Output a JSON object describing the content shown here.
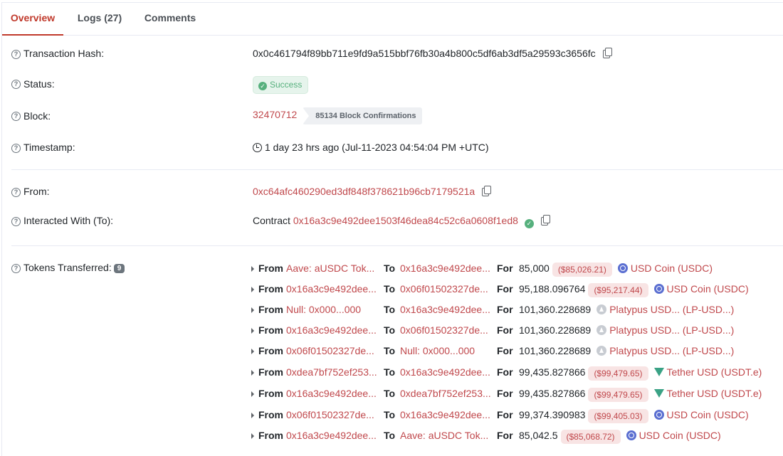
{
  "tabs": [
    {
      "label": "Overview",
      "active": true
    },
    {
      "label": "Logs (27)",
      "active": false
    },
    {
      "label": "Comments",
      "active": false
    }
  ],
  "fields": {
    "tx_hash_label": "Transaction Hash:",
    "tx_hash": "0x0c461794f89bb711e9fd9a515bbf76fb30a4b800c5df6ab3df5a29593c3656fc",
    "status_label": "Status:",
    "status": "Success",
    "block_label": "Block:",
    "block": "32470712",
    "confirmations": "85134 Block Confirmations",
    "timestamp_label": "Timestamp:",
    "timestamp": "1 day 23 hrs ago (Jul-11-2023 04:54:04 PM +UTC)",
    "from_label": "From:",
    "from": "0xc64afc460290ed3df848f378621b96cb7179521a",
    "to_label": "Interacted With (To):",
    "to_prefix": "Contract",
    "to": "0x16a3c9e492dee1503f46dea84c52c6a0608f1ed8",
    "tokens_label": "Tokens Transferred:",
    "tokens_count": "9"
  },
  "transfer_keywords": {
    "from": "From",
    "to": "To",
    "for": "For"
  },
  "transfers": [
    {
      "from": "Aave: aUSDC Tok...",
      "to": "0x16a3c9e492dee...",
      "amount": "85,000",
      "usd": "($85,026.21)",
      "token": "USD Coin (USDC)",
      "icon": "usdc"
    },
    {
      "from": "0x16a3c9e492dee...",
      "to": "0x06f01502327de...",
      "amount": "95,188.096764",
      "usd": "($95,217.44)",
      "token": "USD Coin (USDC)",
      "icon": "usdc"
    },
    {
      "from": "Null: 0x000...000",
      "to": "0x16a3c9e492dee...",
      "amount": "101,360.228689",
      "usd": "",
      "token": "Platypus USD... (LP-USD...)",
      "icon": "lp"
    },
    {
      "from": "0x16a3c9e492dee...",
      "to": "0x06f01502327de...",
      "amount": "101,360.228689",
      "usd": "",
      "token": "Platypus USD... (LP-USD...)",
      "icon": "lp"
    },
    {
      "from": "0x06f01502327de...",
      "to": "Null: 0x000...000",
      "amount": "101,360.228689",
      "usd": "",
      "token": "Platypus USD... (LP-USD...)",
      "icon": "lp"
    },
    {
      "from": "0xdea7bf752ef253...",
      "to": "0x16a3c9e492dee...",
      "amount": "99,435.827866",
      "usd": "($99,479.65)",
      "token": "Tether USD (USDT.e)",
      "icon": "usdt"
    },
    {
      "from": "0x16a3c9e492dee...",
      "to": "0xdea7bf752ef253...",
      "amount": "99,435.827866",
      "usd": "($99,479.65)",
      "token": "Tether USD (USDT.e)",
      "icon": "usdt"
    },
    {
      "from": "0x06f01502327de...",
      "to": "0x16a3c9e492dee...",
      "amount": "99,374.390983",
      "usd": "($99,405.03)",
      "token": "USD Coin (USDC)",
      "icon": "usdc"
    },
    {
      "from": "0x16a3c9e492dee...",
      "to": "Aave: aUSDC Tok...",
      "amount": "85,042.5",
      "usd": "($85,068.72)",
      "token": "USD Coin (USDC)",
      "icon": "usdc"
    }
  ]
}
